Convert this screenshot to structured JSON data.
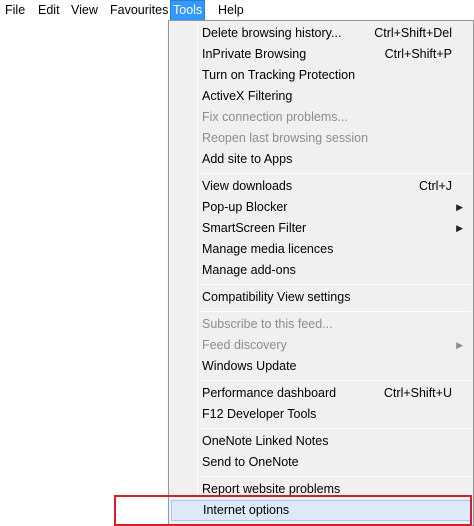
{
  "menubar": {
    "items": [
      {
        "label": "File",
        "active": false
      },
      {
        "label": "Edit",
        "active": false
      },
      {
        "label": "View",
        "active": false
      },
      {
        "label": "Favourites",
        "active": false
      },
      {
        "label": "Tools",
        "active": true
      },
      {
        "label": "Help",
        "active": false
      }
    ]
  },
  "tools_menu": {
    "items": [
      {
        "label": "Delete browsing history...",
        "shortcut": "Ctrl+Shift+Del",
        "enabled": true
      },
      {
        "label": "InPrivate Browsing",
        "shortcut": "Ctrl+Shift+P",
        "enabled": true
      },
      {
        "label": "Turn on Tracking Protection",
        "shortcut": "",
        "enabled": true
      },
      {
        "label": "ActiveX Filtering",
        "shortcut": "",
        "enabled": true
      },
      {
        "label": "Fix connection problems...",
        "shortcut": "",
        "enabled": false
      },
      {
        "label": "Reopen last browsing session",
        "shortcut": "",
        "enabled": false
      },
      {
        "label": "Add site to Apps",
        "shortcut": "",
        "enabled": true
      },
      {
        "label": "View downloads",
        "shortcut": "Ctrl+J",
        "enabled": true
      },
      {
        "label": "Pop-up Blocker",
        "shortcut": "",
        "enabled": true,
        "submenu": true
      },
      {
        "label": "SmartScreen Filter",
        "shortcut": "",
        "enabled": true,
        "submenu": true
      },
      {
        "label": "Manage media licences",
        "shortcut": "",
        "enabled": true
      },
      {
        "label": "Manage add-ons",
        "shortcut": "",
        "enabled": true
      },
      {
        "label": "Compatibility View settings",
        "shortcut": "",
        "enabled": true
      },
      {
        "label": "Subscribe to this feed...",
        "shortcut": "",
        "enabled": false
      },
      {
        "label": "Feed discovery",
        "shortcut": "",
        "enabled": false,
        "submenu": true
      },
      {
        "label": "Windows Update",
        "shortcut": "",
        "enabled": true
      },
      {
        "label": "Performance dashboard",
        "shortcut": "Ctrl+Shift+U",
        "enabled": true
      },
      {
        "label": "F12 Developer Tools",
        "shortcut": "",
        "enabled": true
      },
      {
        "label": "OneNote Linked Notes",
        "shortcut": "",
        "enabled": true
      },
      {
        "label": "Send to OneNote",
        "shortcut": "",
        "enabled": true
      },
      {
        "label": "Report website problems",
        "shortcut": "",
        "enabled": true
      },
      {
        "label": "Internet options",
        "shortcut": "",
        "enabled": true,
        "highlighted": true
      }
    ],
    "submenu_arrow": "▶"
  },
  "annotation": {
    "color": "#d4202a",
    "target": "Internet options"
  },
  "colors": {
    "menu_active": "#3399ff",
    "highlight": "#dde9f8",
    "disabled_text": "#8d8d8d"
  }
}
